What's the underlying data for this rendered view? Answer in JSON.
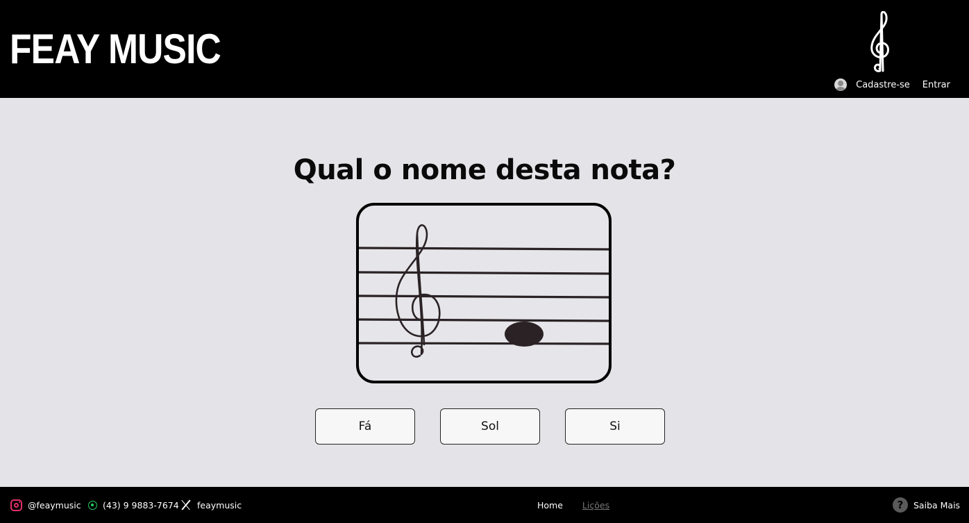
{
  "header": {
    "brand": "FEAY MUSIC",
    "logo_icon": "treble-clef-icon",
    "auth": {
      "avatar_icon": "user-avatar-icon",
      "signup_label": "Cadastre-se",
      "login_label": "Entrar"
    }
  },
  "main": {
    "question": "Qual o nome desta nota?",
    "staff_image": {
      "clef": "treble",
      "note_icon": "whole-note-icon"
    },
    "options": [
      {
        "label": "Fá"
      },
      {
        "label": "Sol"
      },
      {
        "label": "Si"
      }
    ]
  },
  "footer": {
    "instagram": {
      "icon": "instagram-icon",
      "label": "@feaymusic"
    },
    "whatsapp": {
      "icon": "whatsapp-icon",
      "label": "(43) 9 9883-7674"
    },
    "x": {
      "icon": "x-icon",
      "label": "feaymusic"
    },
    "nav": {
      "home": "Home",
      "lessons": "Lições"
    },
    "help": {
      "icon": "help-icon",
      "label": "Saiba Mais"
    }
  },
  "colors": {
    "header_bg": "#000000",
    "page_bg": "#e4e4e8",
    "footer_bg": "#000000",
    "instagram": "#e1306c",
    "whatsapp": "#25d366"
  }
}
